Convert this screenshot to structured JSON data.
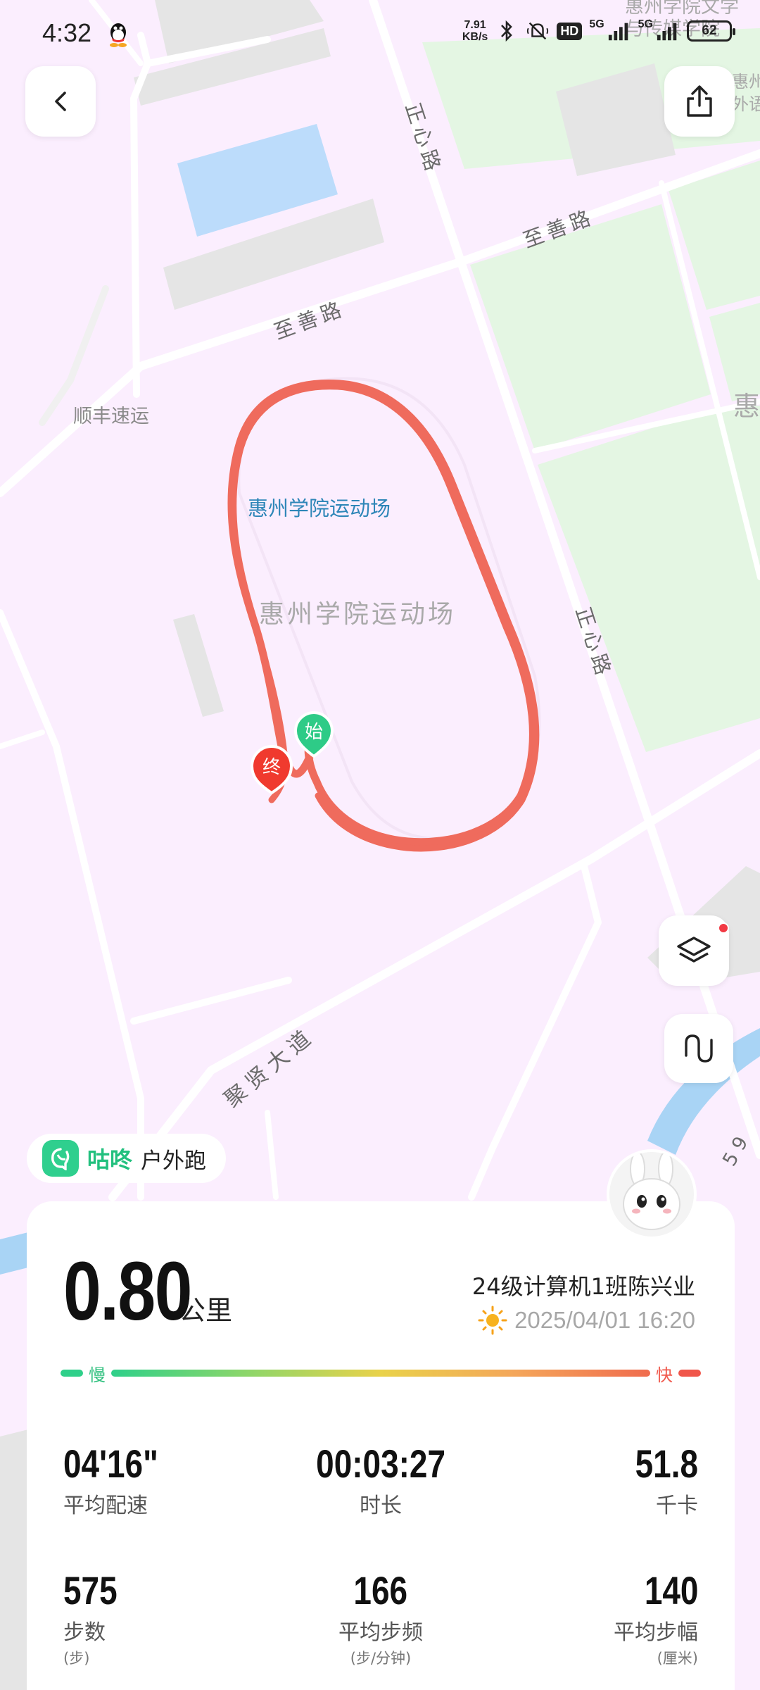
{
  "status_bar": {
    "time": "4:32",
    "net_speed_value": "7.91",
    "net_speed_unit": "KB/s",
    "hd_label": "HD",
    "sig1_label": "5G",
    "sig2_label": "5G",
    "battery": "62"
  },
  "map": {
    "labels": {
      "zhengxin_top": "正心路",
      "zhishan_right": "至善路",
      "zhishan_left": "至善路",
      "shunfeng": "顺丰速运",
      "stadium_poi": "惠州学院运动场",
      "stadium_area": "惠州学院运动场",
      "zhengxin_mid": "正心路",
      "juxian": "聚贤大道",
      "wenxue_1": "惠州学院文学",
      "wenxue_2": "与传媒学院",
      "edge_1": "惠州",
      "edge_2": "外语",
      "edge_3": "惠",
      "edge_num": "5 9"
    },
    "markers": {
      "start": "始",
      "end": "终"
    },
    "route_color": "#ef6b5d"
  },
  "brand": {
    "name": "咕咚",
    "sub": "户外跑"
  },
  "summary": {
    "distance": "0.80",
    "distance_unit": "公里",
    "user": "24级计算机1班陈兴业",
    "datetime": "2025/04/01 16:20",
    "pace_slow": "慢",
    "pace_fast": "快"
  },
  "stats": [
    {
      "value": "04'16\"",
      "label": "平均配速",
      "sub": ""
    },
    {
      "value": "00:03:27",
      "label": "时长",
      "sub": ""
    },
    {
      "value": "51.8",
      "label": "千卡",
      "sub": ""
    },
    {
      "value": "575",
      "label": "步数",
      "sub": "(步)"
    },
    {
      "value": "166",
      "label": "平均步频",
      "sub": "(步/分钟)"
    },
    {
      "value": "140",
      "label": "平均步幅",
      "sub": "(厘米)"
    }
  ],
  "colors": {
    "accent_green": "#22c07e",
    "slow_color": "#2fd08a",
    "fast_color": "#f0564a"
  },
  "icons": [
    "qq-icon",
    "bluetooth-icon",
    "mute-icon",
    "back-icon",
    "share-icon",
    "layers-icon",
    "route-icon",
    "sun-icon",
    "gudong-logo-icon"
  ]
}
